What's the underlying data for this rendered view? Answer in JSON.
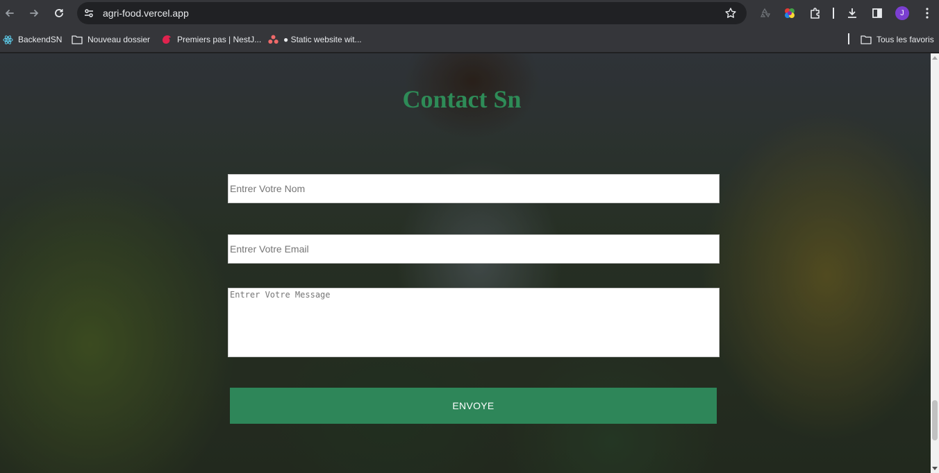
{
  "browser": {
    "url": "agri-food.vercel.app",
    "profile_initial": "J",
    "bookmarks": [
      {
        "label": "BackendSN",
        "icon": "react-icon"
      },
      {
        "label": "Nouveau dossier",
        "icon": "folder-icon"
      },
      {
        "label": "Premiers pas | NestJ...",
        "icon": "nestjs-icon"
      },
      {
        "label": "● Static website wit...",
        "icon": "asana-icon"
      }
    ],
    "all_bookmarks_label": "Tous les favoris"
  },
  "page": {
    "title": "Contact Sn",
    "form": {
      "name_placeholder": "Entrer Votre Nom",
      "email_placeholder": "Entrer Votre Email",
      "message_placeholder": "Entrer Votre Message",
      "submit_label": "ENVOYE"
    },
    "colors": {
      "title": "#2e8b57",
      "button": "#2e8659"
    }
  }
}
